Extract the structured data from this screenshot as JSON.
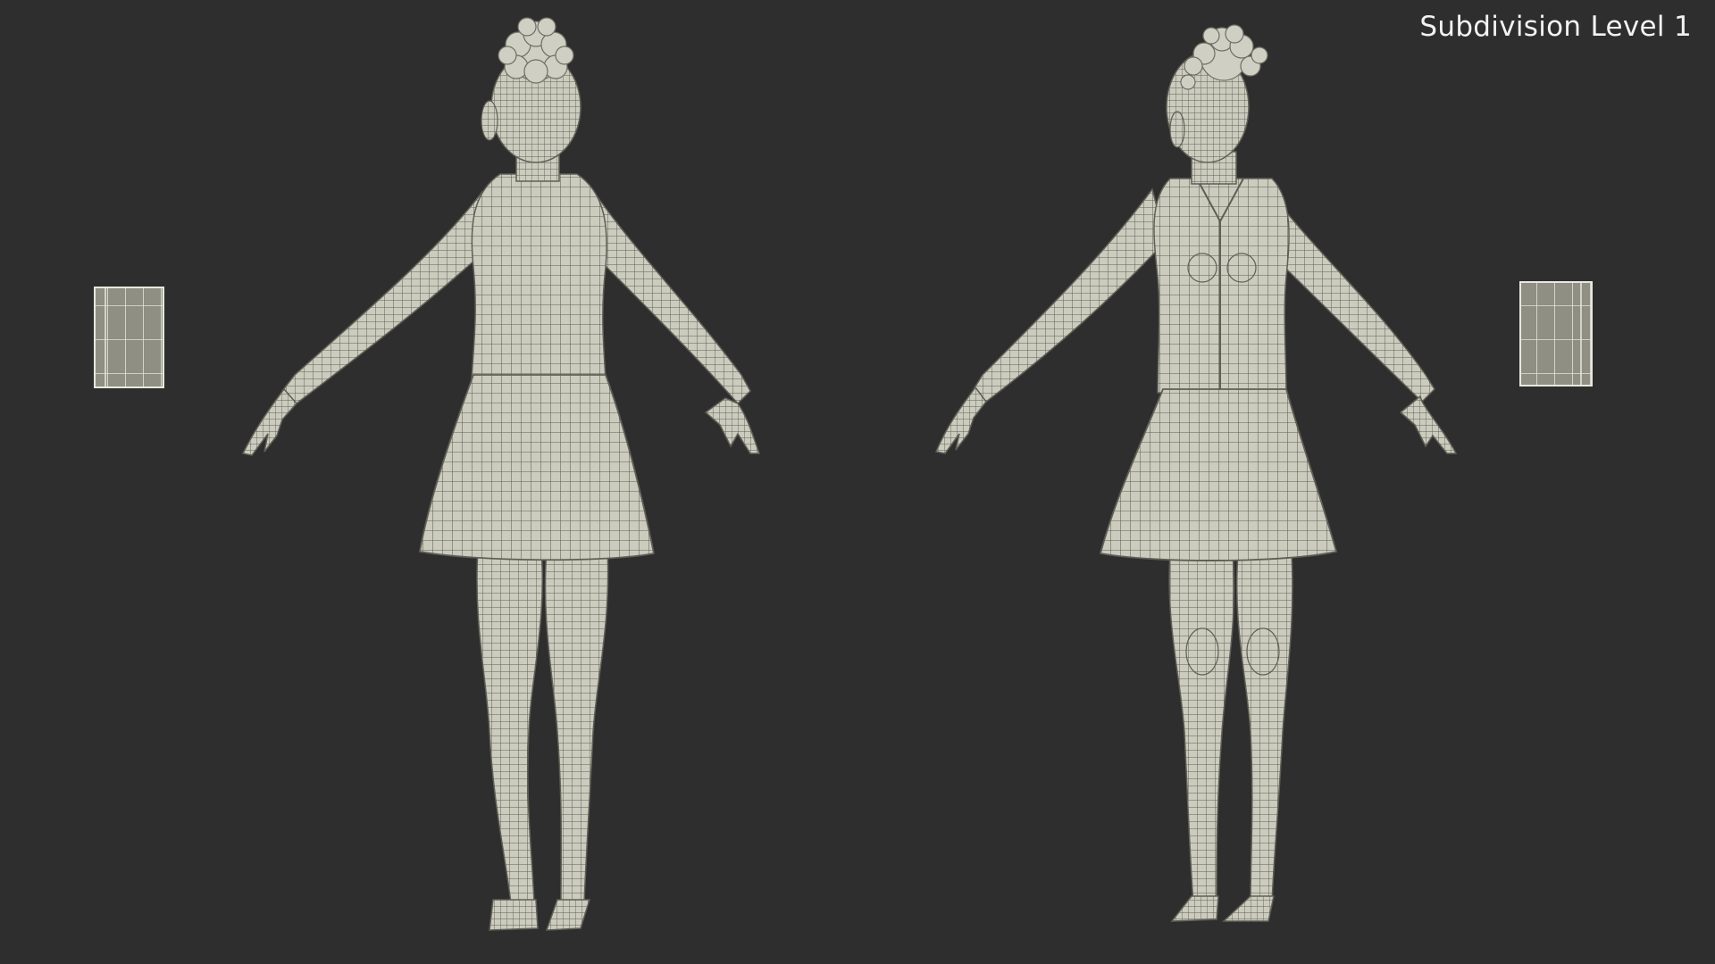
{
  "viewport": {
    "label": "Subdivision Level 1",
    "background": "#2e2e2e",
    "wire_fill": "#ccccbf",
    "wire_line": "#6a6a60"
  },
  "views": [
    {
      "name": "back-view",
      "side": "back"
    },
    {
      "name": "front-view",
      "side": "front"
    }
  ],
  "side_objects": [
    "left-book-prop",
    "right-book-prop"
  ]
}
